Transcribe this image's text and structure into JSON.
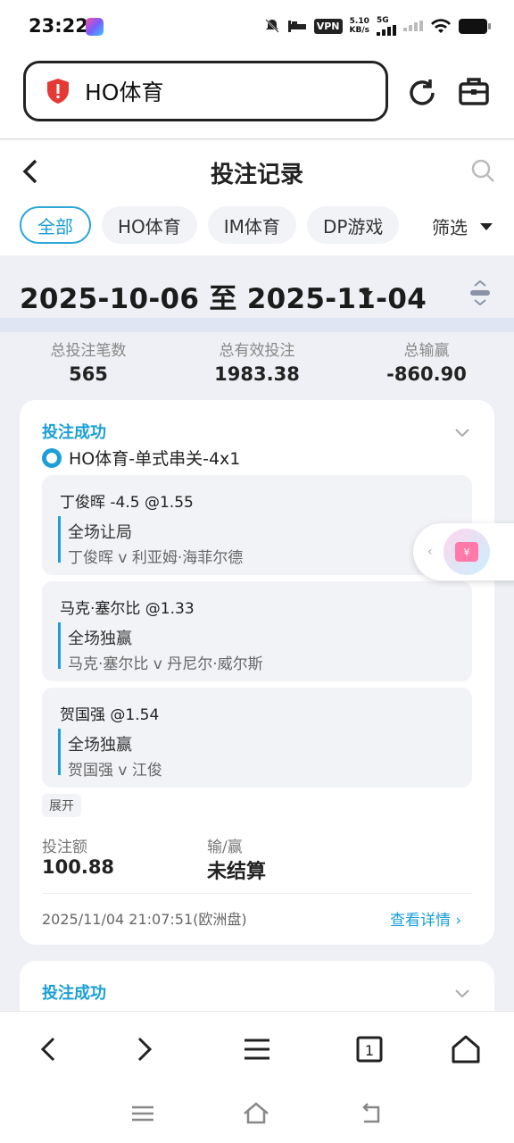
{
  "status_bar": {
    "time": "23:22",
    "vpn": "VPN",
    "speed_value": "5.10",
    "speed_unit": "KB/s",
    "network": "5G"
  },
  "browser": {
    "url_text": "HO体育",
    "icons": [
      "shield-alert-icon",
      "reload-icon",
      "toolbox-icon"
    ]
  },
  "page": {
    "title": "投注记录",
    "tabs": [
      {
        "label": "全部",
        "active": true
      },
      {
        "label": "HO体育",
        "active": false
      },
      {
        "label": "IM体育",
        "active": false
      },
      {
        "label": "DP游戏",
        "active": false
      }
    ],
    "filter_label": "筛选",
    "date_range": "2025-10-06 至 2025-11-04"
  },
  "summary": {
    "total_bets_label": "总投注笔数",
    "total_bets": "565",
    "valid_bets_label": "总有效投注",
    "valid_bets": "1983.38",
    "win_loss_label": "总输赢",
    "win_loss": "-860.90"
  },
  "bet_card": {
    "status": "投注成功",
    "bet_type": "HO体育-单式串关-4x1",
    "legs": [
      {
        "selection": "丁俊晖 -4.5 @1.55",
        "market": "全场让局",
        "match": "丁俊晖 v 利亚姆·海菲尔德"
      },
      {
        "selection": "马克·塞尔比 @1.33",
        "market": "全场独赢",
        "match": "马克·塞尔比 v 丹尼尔·威尔斯"
      },
      {
        "selection": "贺国强 @1.54",
        "market": "全场独赢",
        "match": "贺国强 v 江俊"
      }
    ],
    "expand_label": "展开",
    "stake_label": "投注额",
    "stake": "100.88",
    "result_label": "输/赢",
    "result": "未结算",
    "placed_at": "2025/11/04 21:07:51(欧洲盘)",
    "detail_link": "查看详情 ›"
  },
  "bet_card_2": {
    "status": "投注成功"
  },
  "colors": {
    "accent": "#1b9fd6",
    "background": "#eef0f5",
    "card": "#ffffff"
  }
}
